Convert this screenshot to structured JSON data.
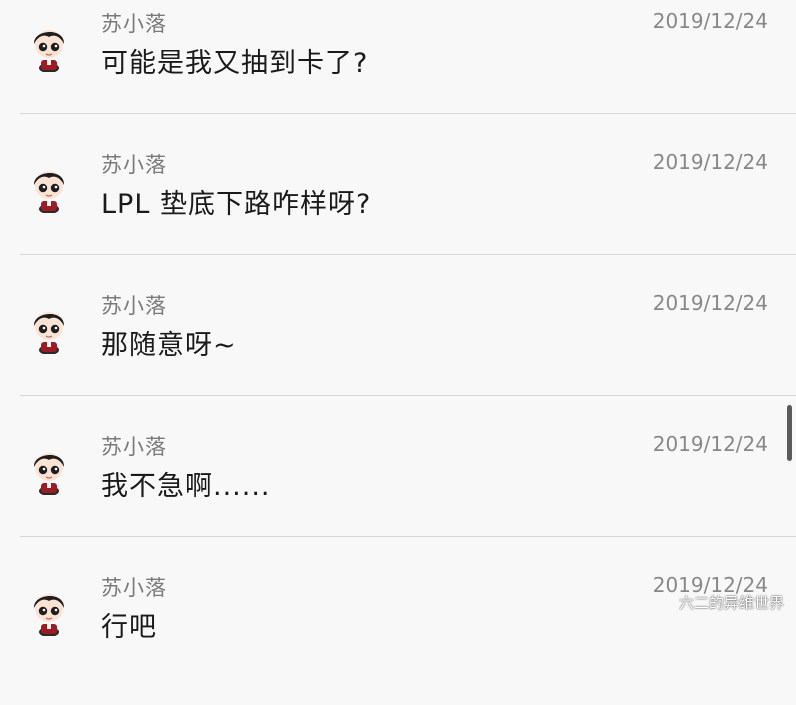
{
  "messages": [
    {
      "sender": "苏小落",
      "date": "2019/12/24",
      "text": "可能是我又抽到卡了?"
    },
    {
      "sender": "苏小落",
      "date": "2019/12/24",
      "text": "LPL 垫底下路咋样呀?"
    },
    {
      "sender": "苏小落",
      "date": "2019/12/24",
      "text": "那随意呀~"
    },
    {
      "sender": "苏小落",
      "date": "2019/12/24",
      "text": "我不急啊......"
    },
    {
      "sender": "苏小落",
      "date": "2019/12/24",
      "text": "行吧"
    }
  ],
  "avatar_icon": "cartoon-boy-avatar-icon",
  "watermark": "六二的异维世界"
}
